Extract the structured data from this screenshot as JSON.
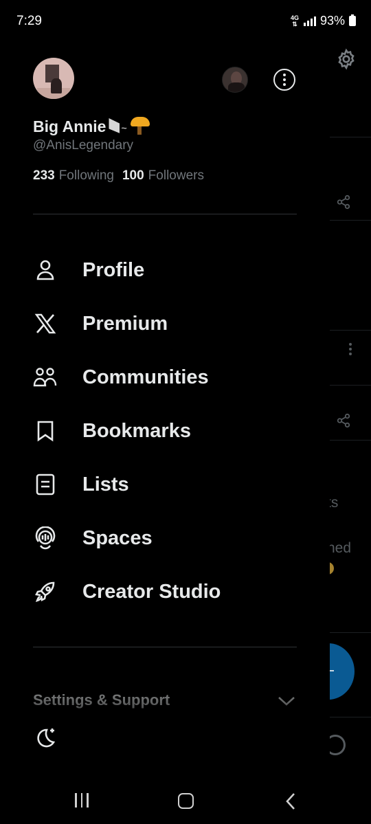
{
  "status_bar": {
    "time": "7:29",
    "network": "4G",
    "battery": "93%"
  },
  "profile": {
    "display_name": "Big Annie",
    "handle": "@AnisLegendary",
    "following_count": "233",
    "following_label": "Following",
    "followers_count": "100",
    "followers_label": "Followers"
  },
  "menu": [
    {
      "label": "Profile",
      "icon": "person-icon"
    },
    {
      "label": "Premium",
      "icon": "x-logo-icon"
    },
    {
      "label": "Communities",
      "icon": "communities-icon"
    },
    {
      "label": "Bookmarks",
      "icon": "bookmark-icon"
    },
    {
      "label": "Lists",
      "icon": "list-icon"
    },
    {
      "label": "Spaces",
      "icon": "spaces-icon"
    },
    {
      "label": "Creator Studio",
      "icon": "rocket-icon"
    }
  ],
  "settings_section": {
    "label": "Settings & Support"
  },
  "background": {
    "partial_text_1": "ts",
    "partial_text_2": "ned"
  },
  "colors": {
    "background": "#000000",
    "text": "#e7e9ea",
    "muted": "#71767b",
    "divider": "#2f3336",
    "accent": "#1d9bf0"
  }
}
